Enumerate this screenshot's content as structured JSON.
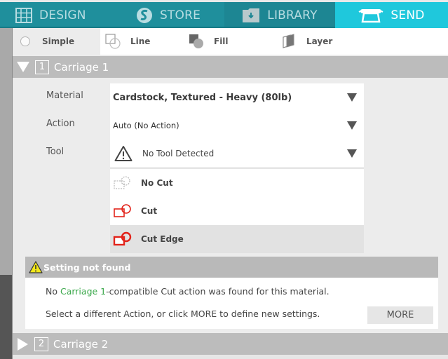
{
  "nav": {
    "tabs": [
      {
        "label": "DESIGN",
        "icon": "grid-icon",
        "active": false
      },
      {
        "label": "STORE",
        "icon": "store-logo-icon",
        "active": false
      },
      {
        "label": "LIBRARY",
        "icon": "library-download-icon",
        "active": false
      },
      {
        "label": "SEND",
        "icon": "cutter-machine-icon",
        "active": true
      }
    ],
    "colors": {
      "bar": "#1f8f9c",
      "active": "#1fc8dc"
    }
  },
  "modes": [
    {
      "label": "Simple",
      "icon": "radio-icon",
      "active": true
    },
    {
      "label": "Line",
      "icon": "line-mode-icon",
      "active": false
    },
    {
      "label": "Fill",
      "icon": "fill-mode-icon",
      "active": false
    },
    {
      "label": "Layer",
      "icon": "layer-mode-icon",
      "active": false
    }
  ],
  "carriage1": {
    "number": "1",
    "title": "Carriage 1",
    "expanded": true,
    "settings": {
      "material_label": "Material",
      "material_value": "Cardstock, Textured - Heavy (80lb)",
      "action_label": "Action",
      "action_value": "Auto (No Action)",
      "tool_label": "Tool",
      "tool_value": "No Tool Detected"
    },
    "tool_options": [
      {
        "label": "No Cut",
        "icon": "no-cut-icon",
        "selected": false
      },
      {
        "label": "Cut",
        "icon": "cut-icon",
        "selected": false
      },
      {
        "label": "Cut Edge",
        "icon": "cut-edge-icon",
        "selected": true
      }
    ]
  },
  "warning": {
    "title": "Setting not found",
    "line1_prefix": "No ",
    "line1_highlight": "Carriage 1",
    "line1_suffix": "-compatible Cut action was found for this material.",
    "line2": "Select a different Action, or click MORE to define new settings.",
    "more_label": "MORE",
    "highlight_color": "#3aa84a"
  },
  "carriage2": {
    "number": "2",
    "title": "Carriage 2",
    "expanded": false
  }
}
